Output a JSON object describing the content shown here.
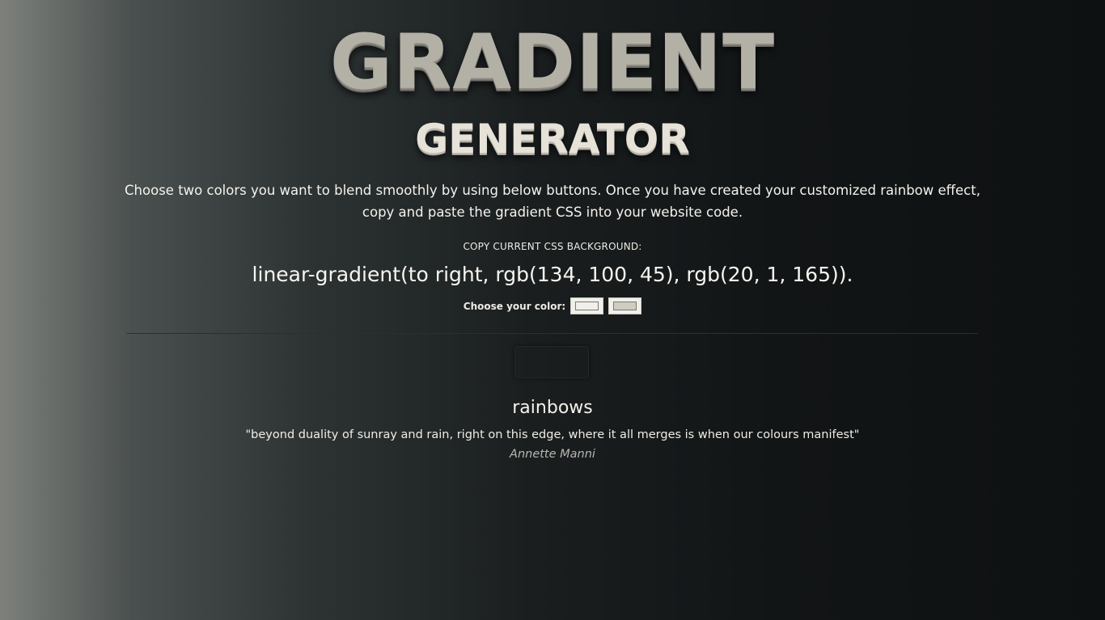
{
  "header": {
    "title": "GRADIENT",
    "subtitle": "GENERATOR"
  },
  "description": "Choose two colors you want to blend smoothly by using below buttons. Once you have created your customized rainbow effect, copy and paste the gradient CSS into your website code.",
  "css_output": {
    "label": "COPY CURRENT CSS BACKGROUND:",
    "value": "linear-gradient(to right, rgb(134, 100, 45), rgb(20, 1, 165))."
  },
  "color_picker": {
    "label": "Choose your color:",
    "color_1": "#f1efe9",
    "color_2": "#cfccc2"
  },
  "quote": {
    "heading": "rainbows",
    "text": "\"beyond duality of sunray and rain, right on this edge, where it all merges is when our colours manifest\"",
    "author": "Annette Manni"
  },
  "colors": {
    "title": "#b3b0a6",
    "subtitle": "#e6e2d8",
    "text": "#f2f0ea",
    "background_left": "#7d807b",
    "background_right": "#0e1112"
  }
}
